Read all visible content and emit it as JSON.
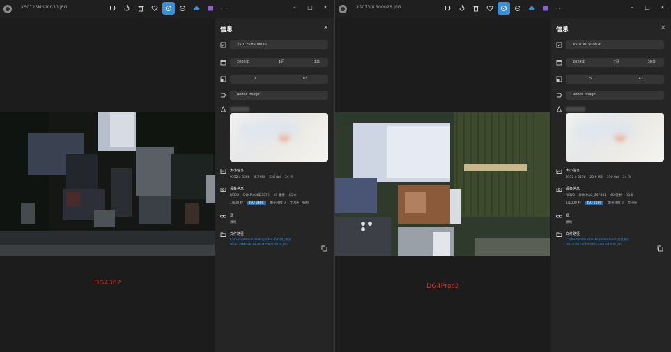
{
  "windows": [
    {
      "filename": "XS0725MS00030.JPG",
      "caption": "DG4362",
      "panel": {
        "title": "信息",
        "name_value": "XS0725MS00030",
        "date": {
          "year": "2000年",
          "month": "1月",
          "day": "1日"
        },
        "time": {
          "hour": "0",
          "minute": "03"
        },
        "source": "Redox Image",
        "size_title": "大小信息",
        "size_line": [
          "9552 x 6368",
          "4.7 MB",
          "350 dpi",
          "24 位"
        ],
        "device_title": "设备信息",
        "device_line1": [
          "REDO",
          "DG4Pro36D3575",
          "40 毫米",
          "f/5.6"
        ],
        "device_line2": [
          "1/640 秒",
          "ISO 3600",
          "曝光补偿 0",
          "无闪光，强制"
        ],
        "source_title": "源",
        "source_sub": "源地",
        "path_title": "文件路径",
        "path_text": "C:\\Users\\Admin\\Desktop\\DG4362\\对比测试\\XS0725MS00030\\XS0725MS00030.JPG"
      }
    },
    {
      "filename": "XS0730LS00026.JPG",
      "caption": "DG4Pros2",
      "panel": {
        "title": "信息",
        "name_value": "XS0730LS00026",
        "date": {
          "year": "2024年",
          "month": "7月",
          "day": "30日"
        },
        "time": {
          "hour": "5",
          "minute": "42"
        },
        "source": "Redox Image",
        "size_title": "大小信息",
        "size_line": [
          "9552 x 5456",
          "20.6 MB",
          "350 dpi",
          "24 位"
        ],
        "device_title": "设备信息",
        "device_line1": [
          "REDO",
          "DG4Pro2_24F541",
          "40 毫米",
          "f/5.6"
        ],
        "device_line2": [
          "1/1000 秒",
          "ISO 2500",
          "曝光补偿 0",
          "无闪光"
        ],
        "source_title": "源",
        "source_sub": "源地",
        "path_title": "文件路径",
        "path_text": "C:\\Users\\Admin\\Desktop\\DG4Pros2\\对比测试\\XS0730LS00026\\XS0730LS00026.JPG"
      }
    }
  ],
  "toolbar_more": "···",
  "window_buttons": {
    "minimize": "–",
    "maximize": "□",
    "close": "✕"
  },
  "colors": {
    "accent": "#3b8fd6",
    "caption": "#e0312b",
    "link": "#3a8ed8"
  }
}
